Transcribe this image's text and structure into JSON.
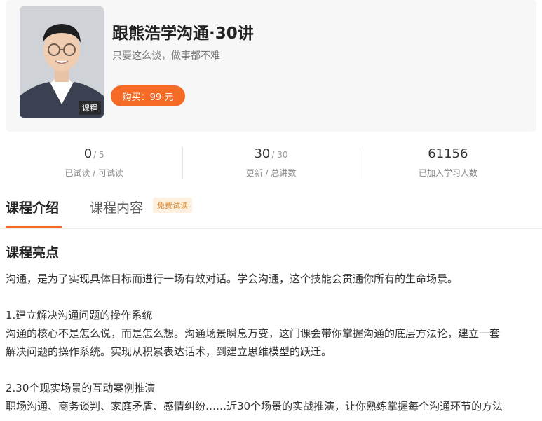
{
  "course": {
    "title": "跟熊浩学沟通·30讲",
    "subtitle": "只要这么谈，做事都不难",
    "cover_tag": "课程",
    "buy_label": "购买：99 元"
  },
  "stats": [
    {
      "value": "0",
      "total": "/ 5",
      "label": "已试读 / 可试读"
    },
    {
      "value": "30",
      "total": "/ 30",
      "label": "更新 / 总讲数"
    },
    {
      "value": "61156",
      "total": "",
      "label": "已加入学习人数"
    }
  ],
  "tabs": {
    "intro": "课程介绍",
    "content": "课程内容",
    "free_badge": "免费试读"
  },
  "body": {
    "section_title": "课程亮点",
    "intro": "沟通，是为了实现具体目标而进行一场有效对话。学会沟通，这个技能会贯通你所有的生命场景。",
    "p1_title": "1.建立解决沟通问题的操作系统",
    "p1_line1": "沟通的核心不是怎么说，而是怎么想。沟通场景瞬息万变，这门课会带你掌握沟通的底层方法论，建立一套",
    "p1_line2": "解决问题的操作系统。实现从积累表达话术，到建立思维模型的跃迁。",
    "p2_title": "2.30个现实场景的互动案例推演",
    "p2_line1": "职场沟通、商务谈判、家庭矛盾、感情纠纷……近30个场景的实战推演，让你熟练掌握每个沟通环节的方法"
  },
  "colors": {
    "accent": "#f56a25",
    "badge_bg": "#fdf0df",
    "badge_text": "#d98a2b"
  }
}
